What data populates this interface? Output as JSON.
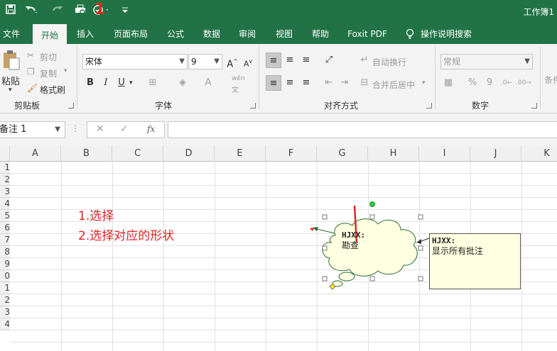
{
  "window": {
    "title": "工作簿1"
  },
  "tabs": [
    "文件",
    "开始",
    "插入",
    "页面布局",
    "公式",
    "数据",
    "审阅",
    "视图",
    "帮助",
    "Foxit PDF",
    "操作说明搜索"
  ],
  "ribbon": {
    "clipboard": {
      "paste": "粘贴",
      "cut": "剪切",
      "copy": "复制",
      "format_painter": "格式刷",
      "label": "剪贴板"
    },
    "font": {
      "name": "宋体",
      "size": "9",
      "label": "字体",
      "bold": "B",
      "italic": "I",
      "underline": "U",
      "phonetic": "wén"
    },
    "alignment": {
      "wrap": "自动换行",
      "merge": "合并后居中",
      "label": "对齐方式"
    },
    "number": {
      "format": "常规",
      "percent": "%",
      "comma": "9",
      "label": "数字"
    },
    "styles": {
      "partial": "条件"
    }
  },
  "formula_bar": {
    "name_box": "备注 1",
    "fx": "fx",
    "value": ""
  },
  "columns": [
    "A",
    "B",
    "C",
    "D",
    "E",
    "F",
    "G",
    "H",
    "I",
    "J",
    "K"
  ],
  "rows": [
    "1",
    "2",
    "3",
    "4",
    "5",
    "6",
    "7",
    "8",
    "9",
    "0",
    "1",
    "2",
    "3",
    "4"
  ],
  "annotations": {
    "step1": "1.选择",
    "step2": "2.选择对应的形状",
    "marker": "1"
  },
  "cloud_comment": {
    "author": "HJXX:",
    "text": "勘查"
  },
  "rect_comment": {
    "author": "HJXX:",
    "text": "显示所有批注"
  },
  "colors": {
    "brand": "#217346",
    "annotation": "#e02424",
    "comment_bg": "#ffffe1"
  }
}
